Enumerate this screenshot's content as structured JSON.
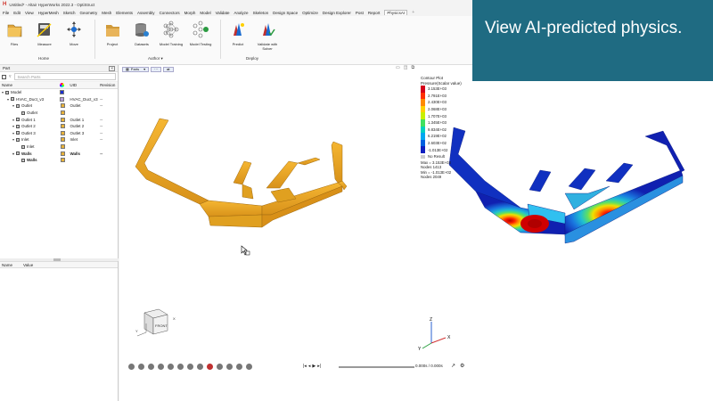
{
  "window": {
    "title": "Untitled* - Altair HyperWorks 2022.3 - OptiStruct",
    "logo": "H"
  },
  "menu": [
    "File",
    "Edit",
    "View",
    "HyperMesh",
    "Sketch",
    "Geometry",
    "Mesh",
    "Elements",
    "Assembly",
    "Connectors",
    "Morph",
    "Model",
    "Validate",
    "Analyze",
    "Skeleton",
    "Design Space",
    "Optimize",
    "Design Explorer",
    "Post",
    "Report",
    "PhysicsAI"
  ],
  "menu_active": "PhysicsAI",
  "menu_plus": "+",
  "ribbon": {
    "buttons": [
      {
        "label": "Files",
        "icon": "files-icon"
      },
      {
        "label": "Measure",
        "icon": "measure-icon"
      },
      {
        "label": "Move",
        "icon": "move-icon"
      },
      {
        "label": "Project",
        "icon": "project-folder-icon"
      },
      {
        "label": "Datasets",
        "icon": "datasets-icon"
      },
      {
        "label": "Model Training",
        "icon": "model-training-icon"
      },
      {
        "label": "Model Testing",
        "icon": "model-testing-icon"
      },
      {
        "label": "Predict",
        "icon": "predict-icon"
      },
      {
        "label": "Validate with\nSolver",
        "icon": "validate-icon"
      }
    ],
    "groups": [
      "Home",
      "Author ▾",
      "Deploy"
    ]
  },
  "banner": {
    "text": "View AI-predicted physics."
  },
  "left_panel": {
    "title": "Part",
    "search_placeholder": "Search Parts",
    "columns": [
      "Name",
      "",
      "UID",
      "Revision"
    ],
    "rows": [
      {
        "name": "Model",
        "indent": 0,
        "uid": "",
        "rev": "",
        "color": "#1a2fd0",
        "bold": false
      },
      {
        "name": "HVAC_Duct_v3",
        "indent": 1,
        "uid": "HVAC_Duct_v3",
        "rev": "--",
        "color": "#b89cd9",
        "bold": false
      },
      {
        "name": "Outlet",
        "indent": 2,
        "uid": "Outlet",
        "rev": "--",
        "color": "#e8b23a",
        "bold": false
      },
      {
        "name": "Outlet",
        "indent": 3,
        "uid": "",
        "rev": "",
        "color": "#e8b23a",
        "bold": false
      },
      {
        "name": "Outlet 1",
        "indent": 2,
        "uid": "Outlet 1",
        "rev": "--",
        "color": "#e8b23a",
        "bold": false
      },
      {
        "name": "Outlet 2",
        "indent": 2,
        "uid": "Outlet 2",
        "rev": "--",
        "color": "#e8b23a",
        "bold": false
      },
      {
        "name": "Outlet 3",
        "indent": 2,
        "uid": "Outlet 3",
        "rev": "--",
        "color": "#e8b23a",
        "bold": false
      },
      {
        "name": "Inlet",
        "indent": 2,
        "uid": "Inlet",
        "rev": "--",
        "color": "#e8b23a",
        "bold": false
      },
      {
        "name": "Inlet",
        "indent": 3,
        "uid": "",
        "rev": "",
        "color": "#e8b23a",
        "bold": false
      },
      {
        "name": "Walls",
        "indent": 2,
        "uid": "Walls",
        "rev": "--",
        "color": "#e8b23a",
        "bold": true
      },
      {
        "name": "Walls",
        "indent": 3,
        "uid": "",
        "rev": "",
        "color": "#e8b23a",
        "bold": true
      }
    ],
    "props_columns": [
      "Name",
      "Value"
    ]
  },
  "viewport": {
    "tab": "Parts",
    "contour": {
      "title": "Contour Plot",
      "subtitle": "Pressure(Scalar value)",
      "values": [
        "3.153E+03",
        "2.791E+03",
        "2.430E+03",
        "2.068E+03",
        "1.707E+03",
        "1.345E+03",
        "9.834E+02",
        "6.219E+02",
        "2.603E+02",
        "-1.013E+02"
      ],
      "colors": [
        "#d4001a",
        "#ff3000",
        "#ff8a00",
        "#ffd000",
        "#c8f000",
        "#40e060",
        "#00d0c0",
        "#00a8f0",
        "#0060e0",
        "#1020c0"
      ],
      "no_result": "No Result",
      "max": "Max = 3.153E+03",
      "max_nodes": "Nodes 1413",
      "min": "Min = -1.013E+02",
      "min_nodes": "Nodes 2049"
    },
    "time": "0.000s / 0.000s",
    "axes": {
      "x": "X",
      "y": "Y",
      "z": "Z"
    },
    "cube_label": "FRONT"
  }
}
